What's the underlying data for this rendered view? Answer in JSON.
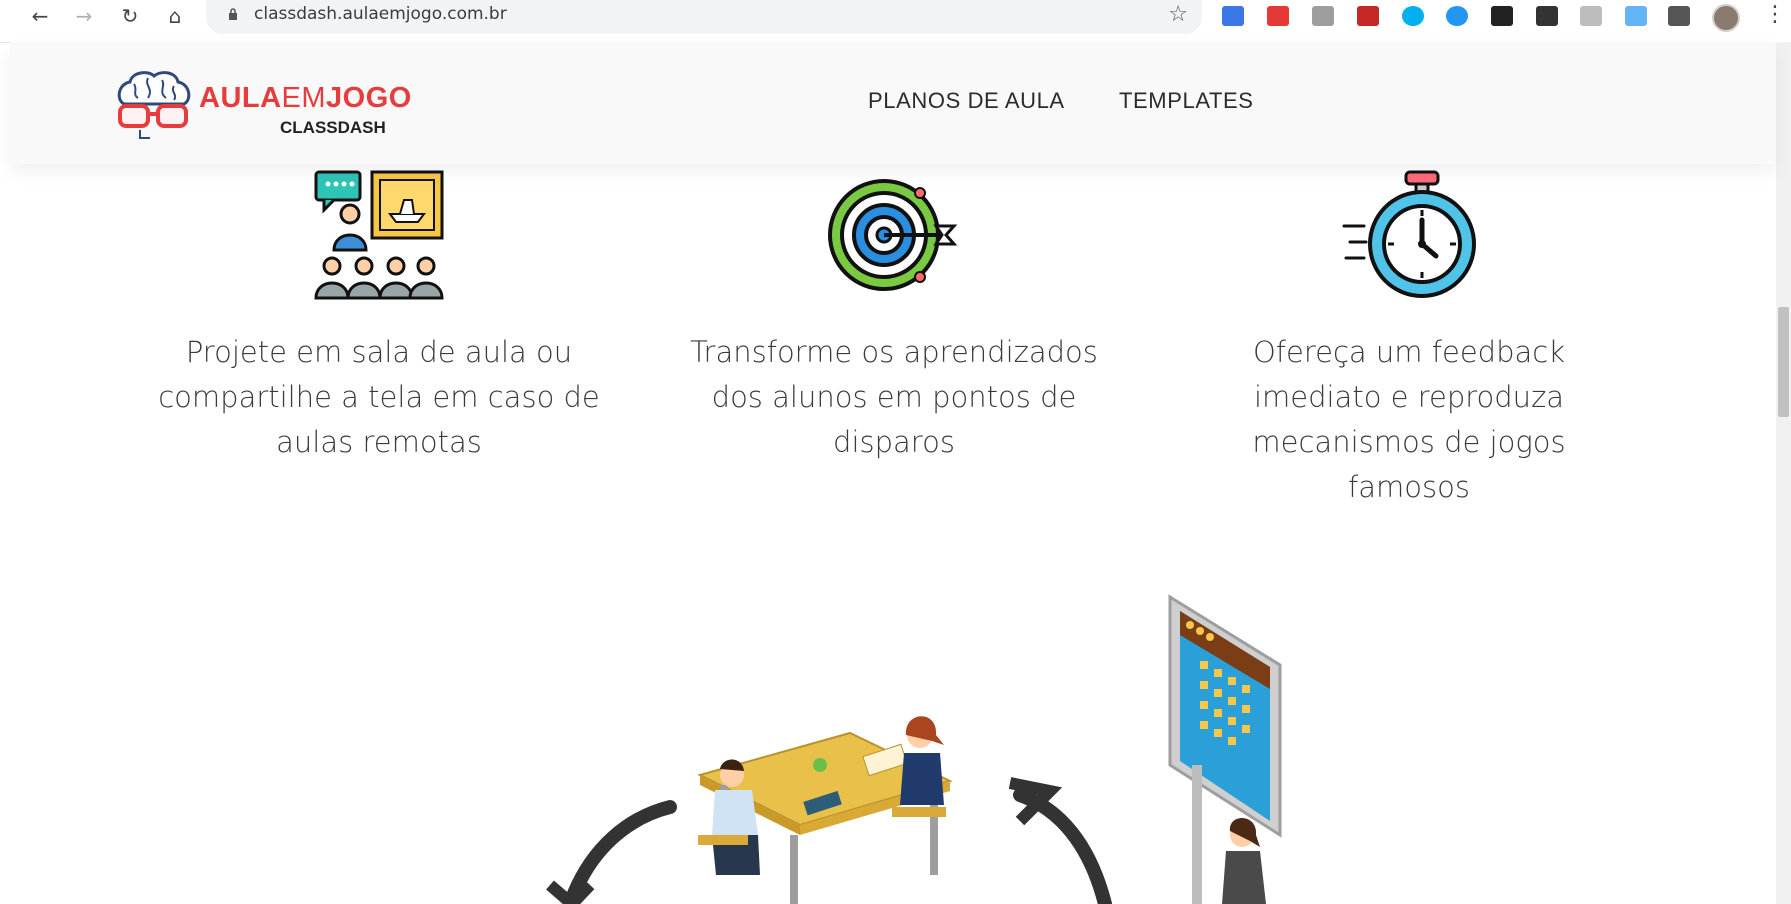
{
  "browser": {
    "url": "classdash.aulaemjogo.com.br",
    "back_icon": "arrow-left-icon",
    "forward_icon": "arrow-right-icon",
    "reload_icon": "reload-icon",
    "home_icon": "home-icon"
  },
  "header": {
    "logo": {
      "word1": "AULA",
      "word2": "EM",
      "word3": "JOGO",
      "sub": "CLASSDASH"
    },
    "nav": {
      "planos": "PLANOS DE AULA",
      "templates": "TEMPLATES"
    }
  },
  "features": [
    {
      "icon": "classroom-presentation-icon",
      "line1": "Projete em sala de aula ou",
      "line2": "compartilhe a tela em caso de",
      "line3": "aulas remotas"
    },
    {
      "icon": "target-arrow-icon",
      "line1": "Transforme os aprendizados",
      "line2": "dos alunos em pontos de",
      "line3": "disparos"
    },
    {
      "icon": "stopwatch-icon",
      "line1": "Ofereça um feedback",
      "line2": "imediato e reproduza",
      "line3": "mecanismos de jogos",
      "line4": "famosos"
    }
  ],
  "colors": {
    "brand_red": "#e63c3c",
    "text": "#3a3a3a",
    "header_bg": "#f9f9f9"
  }
}
